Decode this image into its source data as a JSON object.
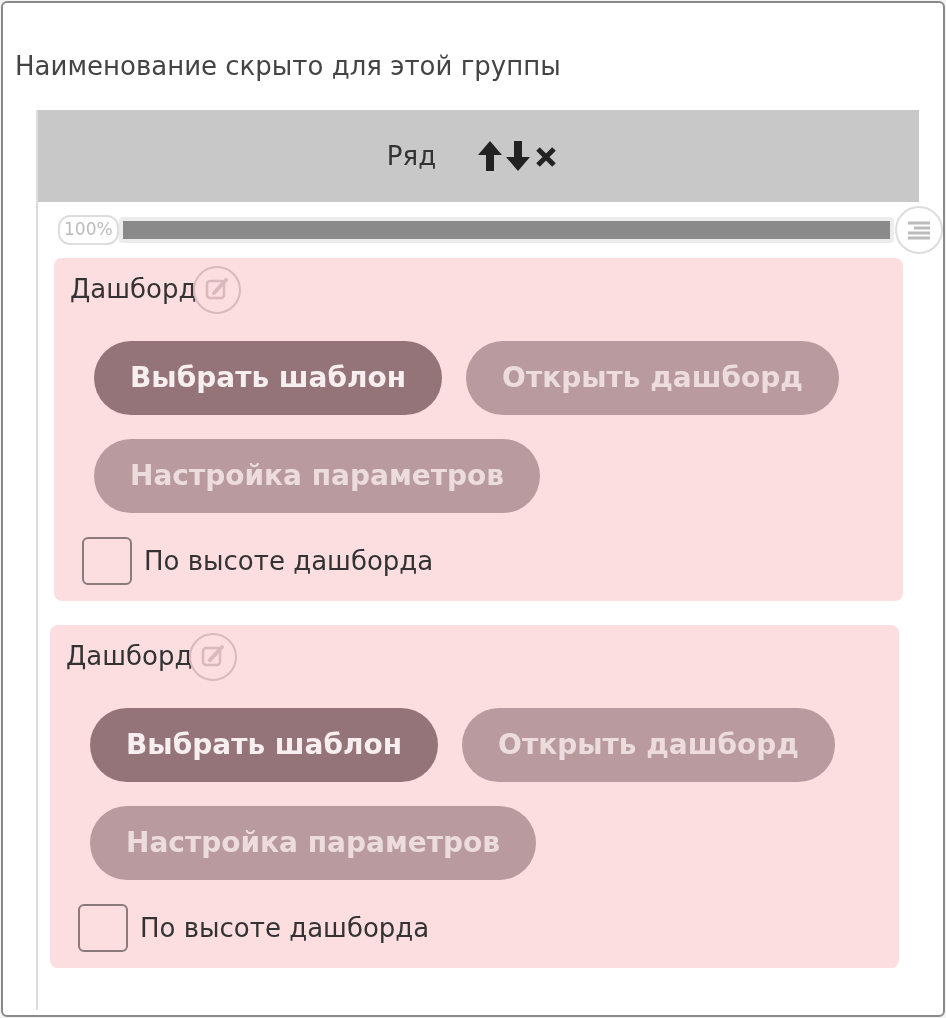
{
  "group_caption": "Наименование скрыто для этой группы",
  "row": {
    "title": "Ряд"
  },
  "slider": {
    "label": "100%",
    "level": 1
  },
  "dashboards": [
    {
      "title": "Дашборд",
      "buttons": [
        {
          "label": "Выбрать шаблон",
          "disabled": false
        },
        {
          "label": "Открыть дашборд",
          "disabled": true
        },
        {
          "label": "Настройка параметров",
          "disabled": true
        }
      ],
      "checkbox": {
        "label": "По высоте дашборда",
        "checked": false
      }
    },
    {
      "title": "Дашборд",
      "buttons": [
        {
          "label": "Выбрать шаблон",
          "disabled": false
        },
        {
          "label": "Открыть дашборд",
          "disabled": true
        },
        {
          "label": "Настройка параметров",
          "disabled": true
        }
      ],
      "checkbox": {
        "label": "По высоте дашборда",
        "checked": false
      }
    }
  ]
}
